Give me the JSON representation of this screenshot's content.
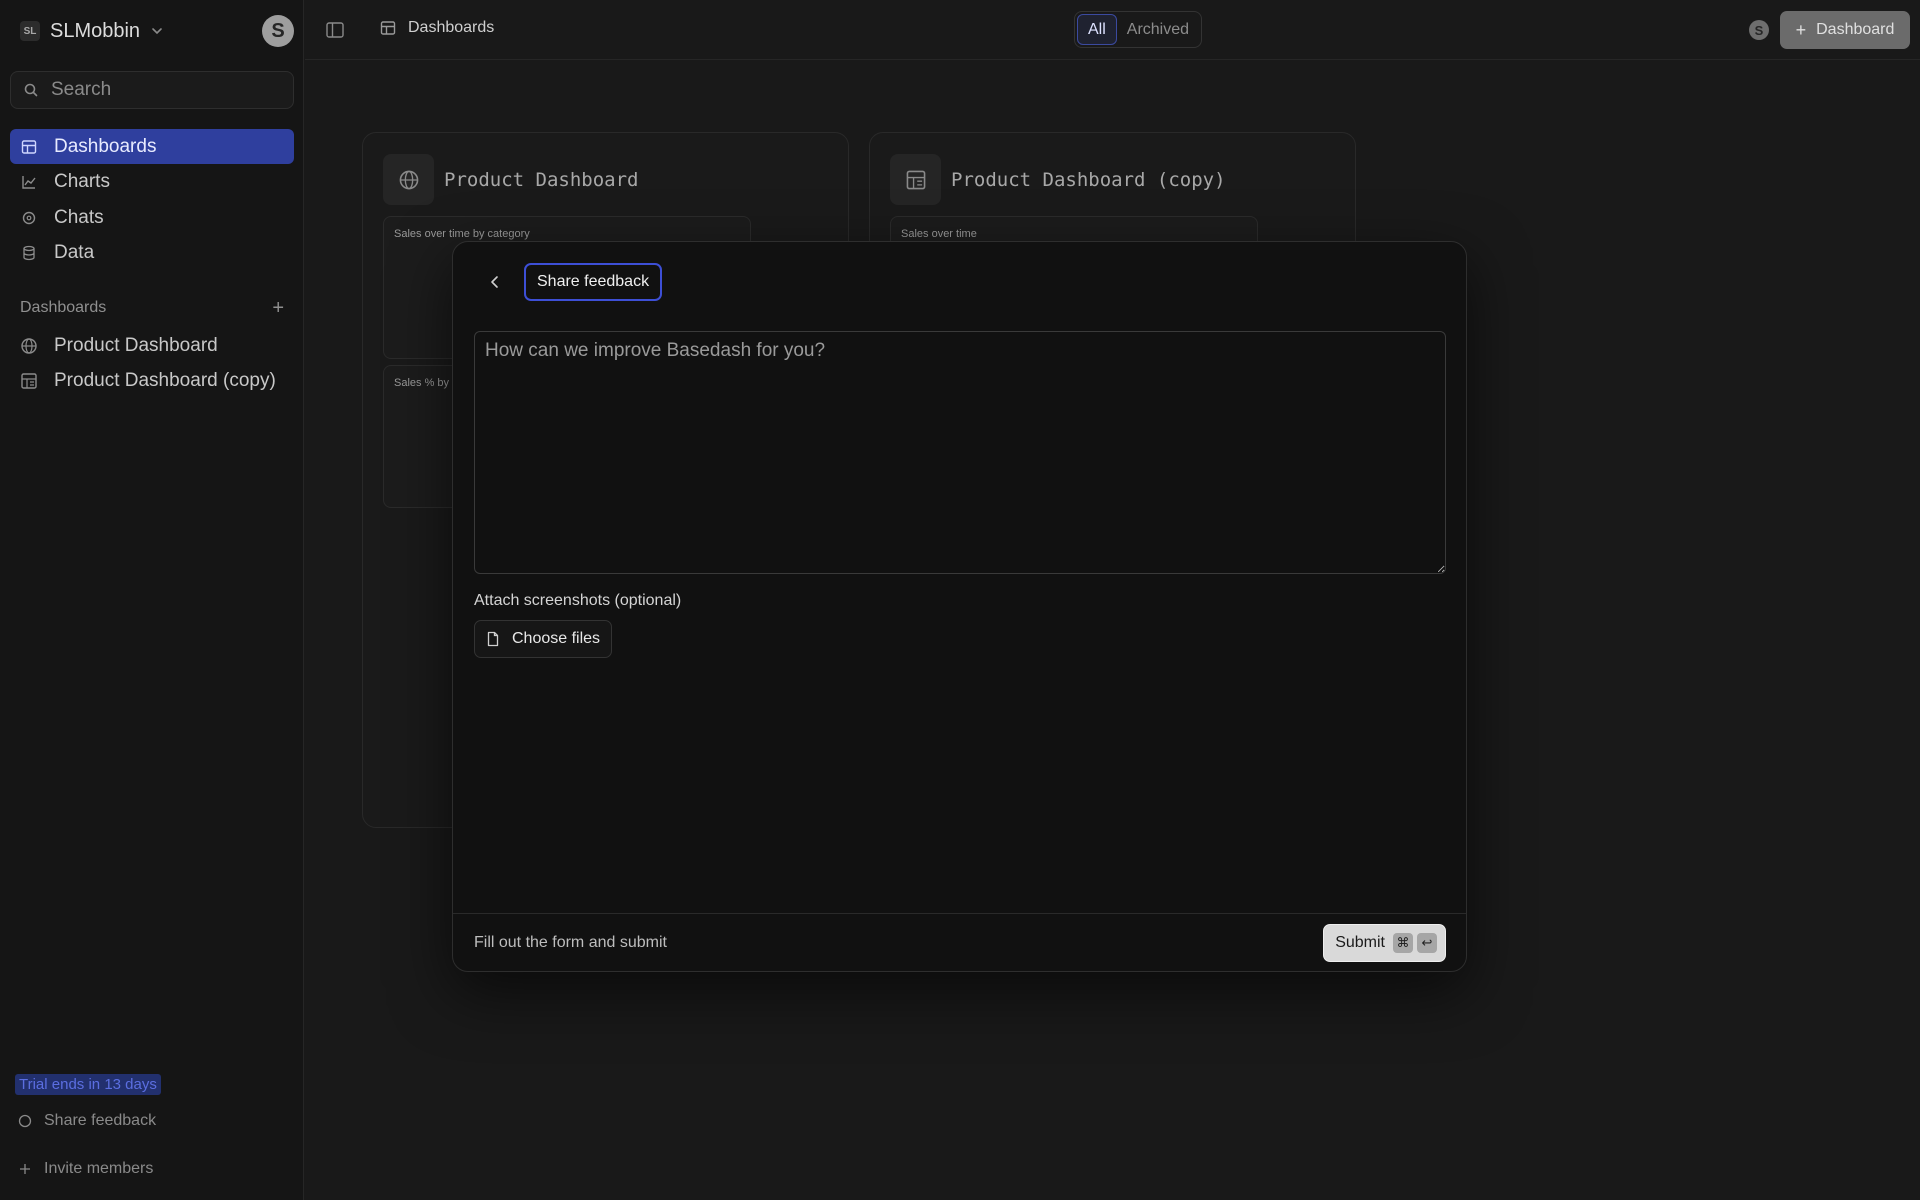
{
  "sidebar": {
    "workspace": {
      "logo": "SL",
      "name": "SLMobbin",
      "avatar": "S"
    },
    "search": {
      "placeholder": "Search",
      "value": ""
    },
    "nav": [
      {
        "label": "Dashboards",
        "icon": "dashboards-icon",
        "active": true
      },
      {
        "label": "Charts",
        "icon": "chart-icon",
        "active": false
      },
      {
        "label": "Chats",
        "icon": "chat-icon",
        "active": false
      },
      {
        "label": "Data",
        "icon": "database-icon",
        "active": false
      }
    ],
    "dashboards_section": {
      "label": "Dashboards",
      "add_symbol": "+"
    },
    "dashboards": [
      {
        "label": "Product Dashboard",
        "icon": "globe-icon"
      },
      {
        "label": "Product Dashboard (copy)",
        "icon": "dashboard-grid-icon"
      }
    ],
    "trial": "Trial ends in 13 days",
    "footer": {
      "share_feedback": "Share feedback",
      "invite_members": "Invite members"
    }
  },
  "topbar": {
    "breadcrumb": "Dashboards",
    "filter": {
      "all": "All",
      "archived": "Archived",
      "selected": "All"
    },
    "user_avatar": "S",
    "new_dashboard": "Dashboard"
  },
  "cards": [
    {
      "title": "Product Dashboard",
      "chart1": "Sales over time by category",
      "chart2": "Sales % by C"
    },
    {
      "title": "Product Dashboard (copy)",
      "chart1": "Sales over time"
    }
  ],
  "modal": {
    "title": "Share feedback",
    "textarea_placeholder": "How can we improve Basedash for you?",
    "textarea_value": "",
    "attach_label": "Attach screenshots (optional)",
    "choose_files": "Choose files",
    "footer_hint": "Fill out the form and submit",
    "submit": "Submit",
    "shortcut": [
      "⌘",
      "↩"
    ]
  },
  "colors": {
    "accent": "#3d4fd6",
    "active_nav_bg": "#2f3f9e",
    "modal_bg": "#111111",
    "page_bg": "#191919"
  }
}
